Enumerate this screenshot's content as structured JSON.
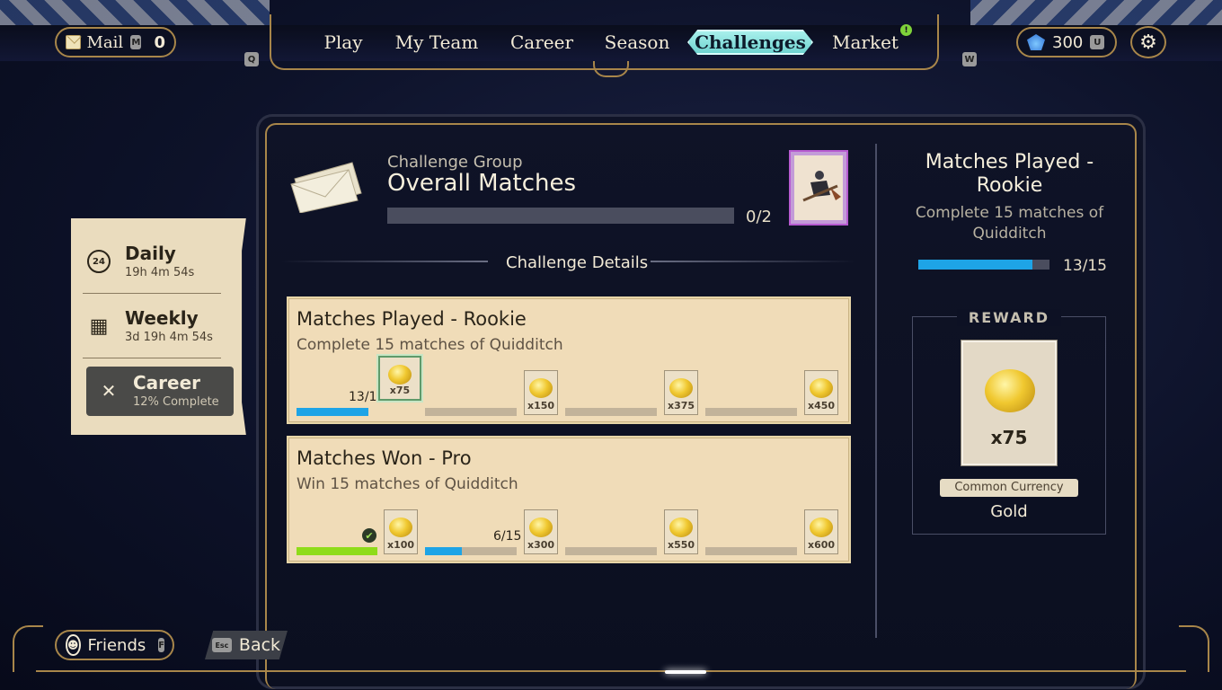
{
  "topbar": {
    "mail_label": "Mail",
    "mail_key": "M",
    "mail_count": "0",
    "key_left": "Q",
    "key_right": "W",
    "tabs": [
      {
        "label": "Play"
      },
      {
        "label": "My Team"
      },
      {
        "label": "Career"
      },
      {
        "label": "Season"
      },
      {
        "label": "Challenges"
      },
      {
        "label": "Market"
      }
    ],
    "active_tab": "Challenges",
    "market_badge": "!",
    "currency_amount": "300",
    "currency_key": "U"
  },
  "sidebar": {
    "items": [
      {
        "title": "Daily",
        "time": "19h 4m 54s",
        "icon": "24h-clock-icon",
        "icon_glyph": "24"
      },
      {
        "title": "Weekly",
        "time": "3d 19h 4m 54s",
        "icon": "calendar-icon",
        "icon_glyph": "▦"
      },
      {
        "title": "Career",
        "time": "12% Complete",
        "icon": "crossed-brooms-icon",
        "icon_glyph": "✕"
      }
    ],
    "active": "Career"
  },
  "group": {
    "label": "Challenge Group",
    "title": "Overall Matches",
    "count": "0/2",
    "progress": 0
  },
  "details_label": "Challenge Details",
  "challenges": [
    {
      "title": "Matches Played - Rookie",
      "subtitle": "Complete 15 matches of Quidditch",
      "progress_text": "13/15",
      "progress": 0.87,
      "rewards": [
        "x75",
        "x150",
        "x375",
        "x450"
      ]
    },
    {
      "title": "Matches Won - Pro",
      "subtitle": "Win 15 matches of Quidditch",
      "progress_text": "6/15",
      "progress": 0.4,
      "rewards": [
        "x100",
        "x300",
        "x550",
        "x600"
      ]
    }
  ],
  "selected": {
    "title": "Matches Played - Rookie",
    "subtitle": "Complete 15 matches of Quidditch",
    "count": "13/15",
    "progress": 0.87,
    "reward_label": "REWARD",
    "reward_amount": "x75",
    "reward_type": "Common Currency",
    "reward_name": "Gold"
  },
  "bottom": {
    "friends_label": "Friends",
    "friends_key": "F",
    "back_key": "Esc",
    "back_label": "Back"
  },
  "colors": {
    "accent_gold": "#a8864a",
    "progress_blue": "#1ea4e6",
    "complete_green": "#8fdc1a",
    "active_tab": "#7ed9d6"
  }
}
